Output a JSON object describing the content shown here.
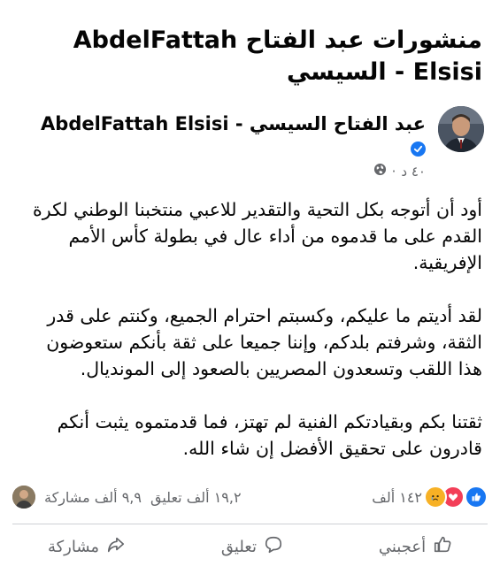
{
  "page": {
    "title": "منشورات عبد الفتاح AbdelFattah Elsisi - السيسي"
  },
  "post": {
    "author": "عبد الفتاح السيسي - AbdelFattah Elsisi",
    "time": "٤٠ د",
    "separator": "·",
    "paragraphs": [
      "أود أن أتوجه بكل التحية والتقدير للاعبي منتخبنا الوطني لكرة القدم على ما قدموه من أداء عال في بطولة كأس الأمم الإفريقية.",
      "لقد أديتم ما عليكم، وكسبتم احترام الجميع، وكنتم على قدر الثقة، وشرفتم بلدكم، وإننا جميعا على ثقة بأنكم ستعوضون هذا اللقب وتسعدون المصريين بالصعود إلى المونديال.",
      "ثقتنا بكم وبقيادتكم الفنية لم تهتز، فما قدمتموه يثبت أنكم قادرون على تحقيق الأفضل إن شاء الله."
    ]
  },
  "stats": {
    "reactions_count": "١٤٢ ألف",
    "shares": "٩,٩ ألف مشاركة",
    "comments": "١٩,٢ ألف تعليق",
    "reaction_icons": [
      "like-icon",
      "love-icon",
      "sad-icon"
    ]
  },
  "actions": {
    "like": "أعجبني",
    "comment": "تعليق",
    "share": "مشاركة"
  },
  "colors": {
    "accent": "#1877f2",
    "love": "#f33e58",
    "sad": "#f7b125",
    "muted": "#65676b"
  }
}
